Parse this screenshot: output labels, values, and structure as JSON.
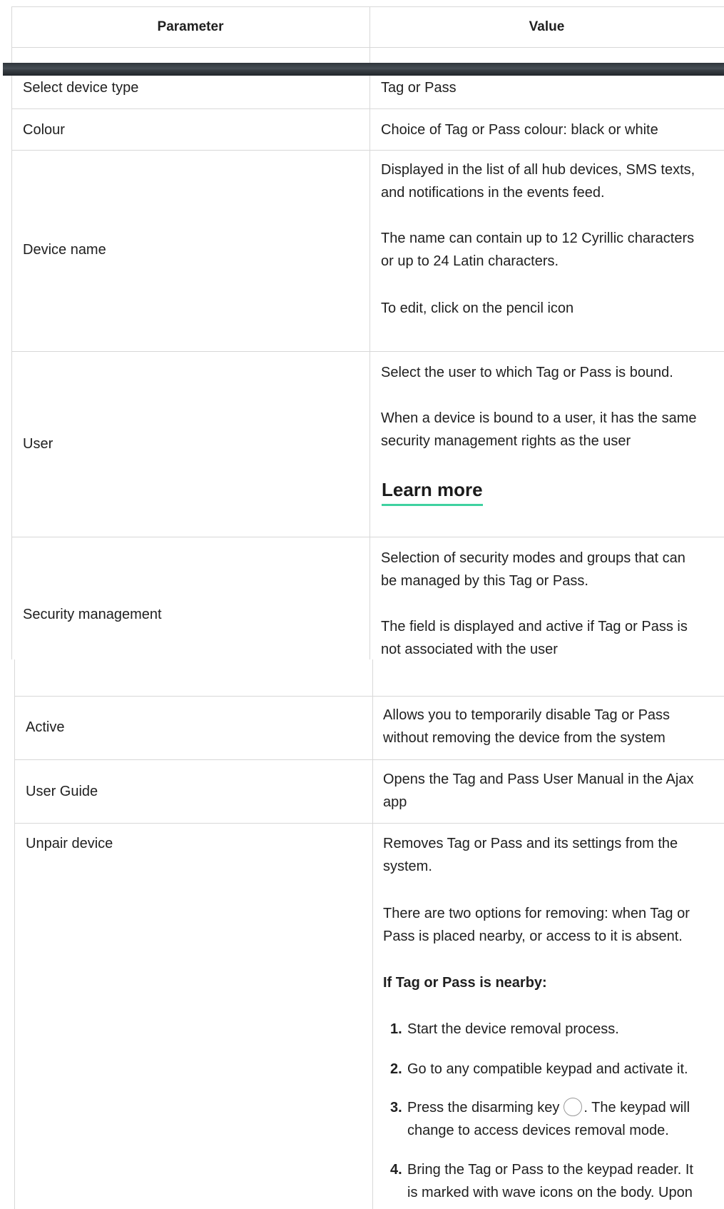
{
  "header": {
    "parameter": "Parameter",
    "value": "Value"
  },
  "rows": {
    "select_device_type": {
      "param": "Select device type",
      "value": "Tag or Pass"
    },
    "colour": {
      "param": "Colour",
      "value": "Choice of Tag or Pass colour: black or white"
    },
    "device_name": {
      "param": "Device name",
      "lines": [
        "Displayed in the list of all hub devices, SMS texts,",
        "and notifications in the events feed.",
        "The name can contain up to 12 Cyrillic characters",
        "or up to 24 Latin characters.",
        "To edit, click on the pencil icon"
      ]
    },
    "user": {
      "param": "User",
      "lines": [
        "Select the user to which Tag or Pass is bound.",
        "When a device is bound to a user, it has the same",
        "security management rights as the user"
      ],
      "learn_more": "Learn more"
    },
    "security_management": {
      "param": "Security management",
      "lines": [
        "Selection of security modes and groups that can",
        "be managed by this Tag or Pass.",
        "The field is displayed and active if Tag or Pass is",
        "not associated with the user"
      ]
    },
    "active": {
      "param": "Active",
      "lines": [
        "Allows you to temporarily disable Tag or Pass",
        "without removing the device from the system"
      ]
    },
    "user_guide": {
      "param": "User Guide",
      "lines": [
        "Opens the Tag and Pass User Manual in the Ajax",
        "app"
      ]
    },
    "unpair_device": {
      "param": "Unpair device",
      "lines": [
        "Removes Tag or Pass and its settings from the",
        "system.",
        "There are two options for removing: when Tag or",
        "Pass is placed nearby, or access to it is absent."
      ],
      "nearby_heading": "If Tag or Pass is nearby:",
      "steps": [
        {
          "num": "1.",
          "lines": [
            "Start the device removal process."
          ]
        },
        {
          "num": "2.",
          "lines": [
            "Go to any compatible keypad and activate it."
          ]
        },
        {
          "num": "3.",
          "pre": "Press the disarming key",
          "post": ". The keypad will",
          "lines": [
            "change to access devices removal mode."
          ]
        },
        {
          "num": "4.",
          "lines": [
            "Bring the Tag or Pass to the keypad reader. It",
            "is marked with wave icons on the body. Upon"
          ]
        }
      ]
    }
  },
  "icons": {
    "disarm_key": "disarm-key-icon"
  }
}
